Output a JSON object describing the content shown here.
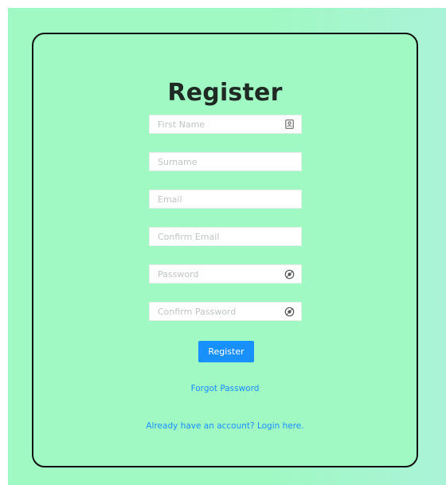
{
  "form": {
    "title": "Register",
    "fields": {
      "first_name": {
        "placeholder": "First Name",
        "value": "",
        "icon": "contact-card-icon"
      },
      "surname": {
        "placeholder": "Surname",
        "value": ""
      },
      "email": {
        "placeholder": "Email",
        "value": ""
      },
      "confirm_email": {
        "placeholder": "Confirm Email",
        "value": ""
      },
      "password": {
        "placeholder": "Password",
        "value": "",
        "icon": "eye-icon"
      },
      "confirm_password": {
        "placeholder": "Confirm Password",
        "value": "",
        "icon": "eye-icon"
      }
    },
    "register_button": "Register",
    "forgot_password_link": "Forgot Password",
    "login_link": "Already have an account? Login here."
  },
  "colors": {
    "background": "#a0f8c3",
    "accent": "#1890ff",
    "card_border": "#111111"
  }
}
